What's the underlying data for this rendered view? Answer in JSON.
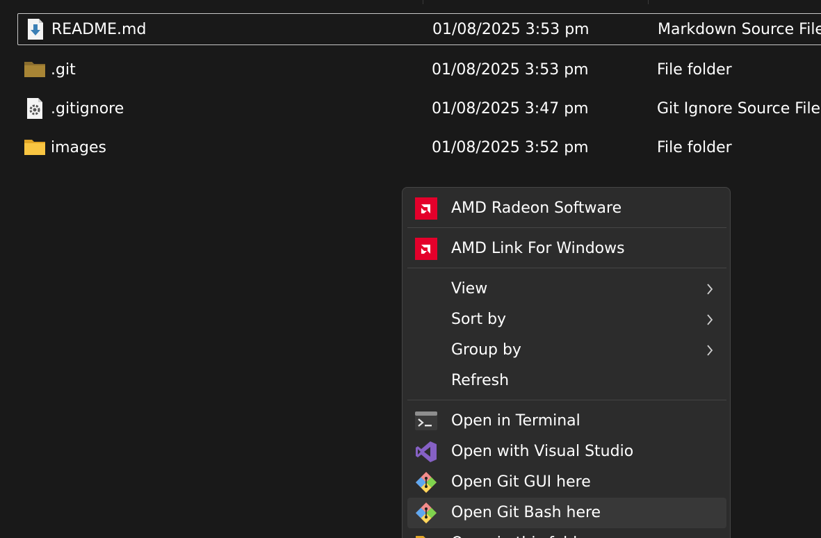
{
  "files": [
    {
      "name": "README.md",
      "date": "01/08/2025 3:53 pm",
      "type": "Markdown Source File",
      "icon": "markdown-file-icon"
    },
    {
      "name": ".git",
      "date": "01/08/2025 3:53 pm",
      "type": "File folder",
      "icon": "folder-dark-icon"
    },
    {
      "name": ".gitignore",
      "date": "01/08/2025 3:47 pm",
      "type": "Git Ignore Source File",
      "icon": "settings-file-icon"
    },
    {
      "name": "images",
      "date": "01/08/2025 3:52 pm",
      "type": "File folder",
      "icon": "folder-icon"
    }
  ],
  "context_menu": {
    "items": [
      {
        "label": "AMD Radeon Software",
        "icon": "amd-icon"
      },
      {
        "label": "AMD Link For Windows",
        "icon": "amd-icon"
      },
      {
        "label": "View",
        "icon": "chevron-right-icon"
      },
      {
        "label": "Sort by",
        "icon": "chevron-right-icon"
      },
      {
        "label": "Group by",
        "icon": "chevron-right-icon"
      },
      {
        "label": "Refresh"
      },
      {
        "label": "Open in Terminal",
        "icon": "terminal-icon"
      },
      {
        "label": "Open with Visual Studio",
        "icon": "visual-studio-icon"
      },
      {
        "label": "Open Git GUI here",
        "icon": "git-gui-icon"
      },
      {
        "label": "Open Git Bash here",
        "icon": "git-bash-icon"
      },
      {
        "label": "Open in this folder",
        "icon": "folder-icon"
      }
    ]
  },
  "colors": {
    "background": "#191919",
    "menu_background": "#2c2c2c",
    "amd_red": "#e4002b",
    "folder_yellow": "#f8c542"
  }
}
